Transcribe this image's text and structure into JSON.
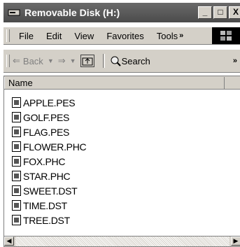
{
  "window": {
    "title": "Removable Disk (H:)",
    "controls": {
      "minimize": "_",
      "maximize": "□",
      "close": "X"
    }
  },
  "menu": {
    "items": [
      "File",
      "Edit",
      "View",
      "Favorites",
      "Tools"
    ],
    "more": "»"
  },
  "toolbar": {
    "back_label": "Back",
    "search_label": "Search",
    "more": "»"
  },
  "file_list": {
    "column_name": "Name",
    "files": [
      "APPLE.PES",
      "GOLF.PES",
      "FLAG.PES",
      "FLOWER.PHC",
      "FOX.PHC",
      "STAR.PHC",
      "SWEET.DST",
      "TIME.DST",
      "TREE.DST"
    ]
  }
}
